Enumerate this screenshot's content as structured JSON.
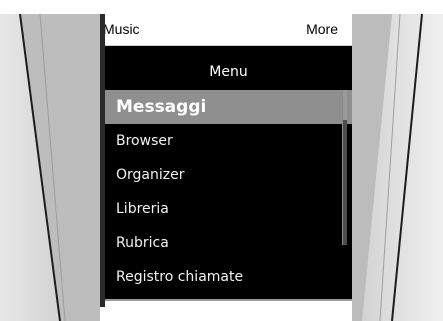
{
  "softkeys": {
    "left": "Music",
    "right": "More"
  },
  "menu": {
    "title": "Menu",
    "items": [
      {
        "label": "Messaggi",
        "selected": true
      },
      {
        "label": "Browser",
        "selected": false
      },
      {
        "label": "Organizer",
        "selected": false
      },
      {
        "label": "Libreria",
        "selected": false
      },
      {
        "label": "Rubrica",
        "selected": false
      },
      {
        "label": "Registro chiamate",
        "selected": false
      }
    ]
  },
  "colors": {
    "background": "#000000",
    "selection": "#8f8f8f",
    "text": "#f2f2f2"
  }
}
